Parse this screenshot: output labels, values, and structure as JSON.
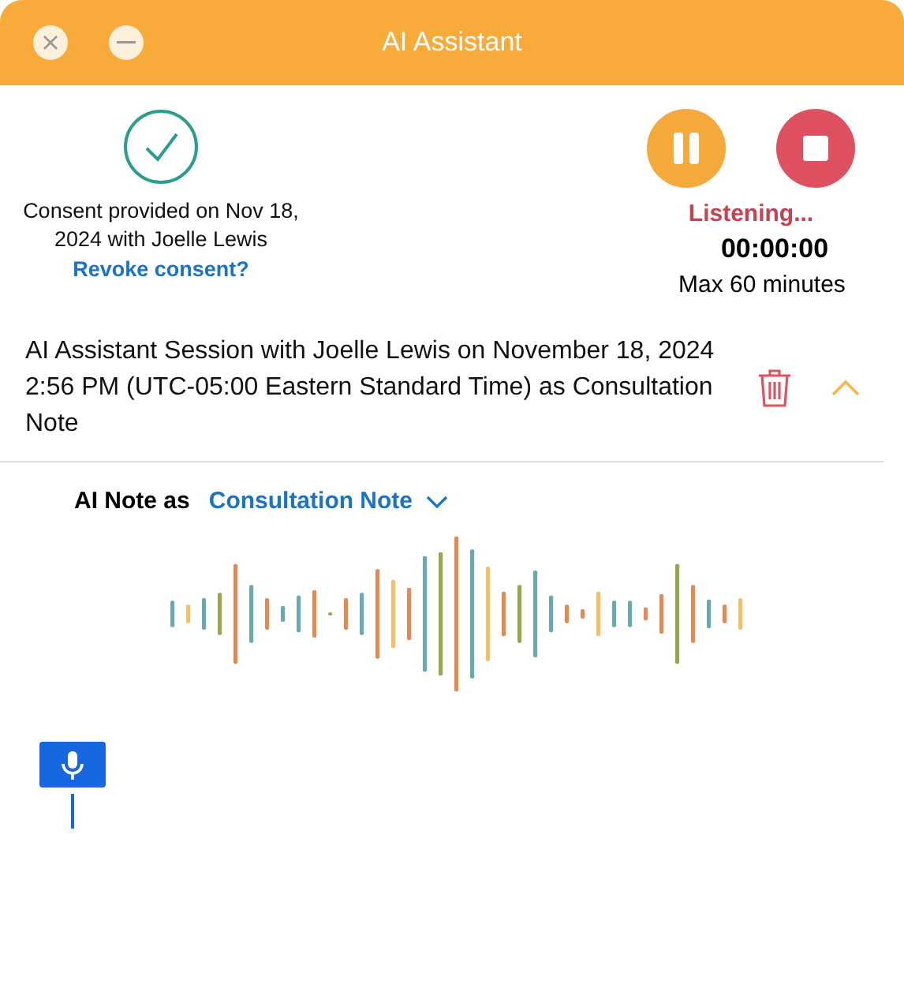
{
  "window": {
    "title": "AI Assistant"
  },
  "consent": {
    "text": "Consent provided on Nov 18, 2024 with Joelle Lewis",
    "link": "Revoke consent?"
  },
  "recording": {
    "status": "Listening...",
    "timer": "00:00:00",
    "limit": "Max 60 minutes"
  },
  "session": {
    "title": "AI Assistant Session with Joelle Lewis on November 18, 2024 2:56 PM (UTC-05:00 Eastern Standard Time) as Consultation Note",
    "expanded": true
  },
  "note": {
    "label": "AI Note as",
    "value": "Consultation Note"
  }
}
